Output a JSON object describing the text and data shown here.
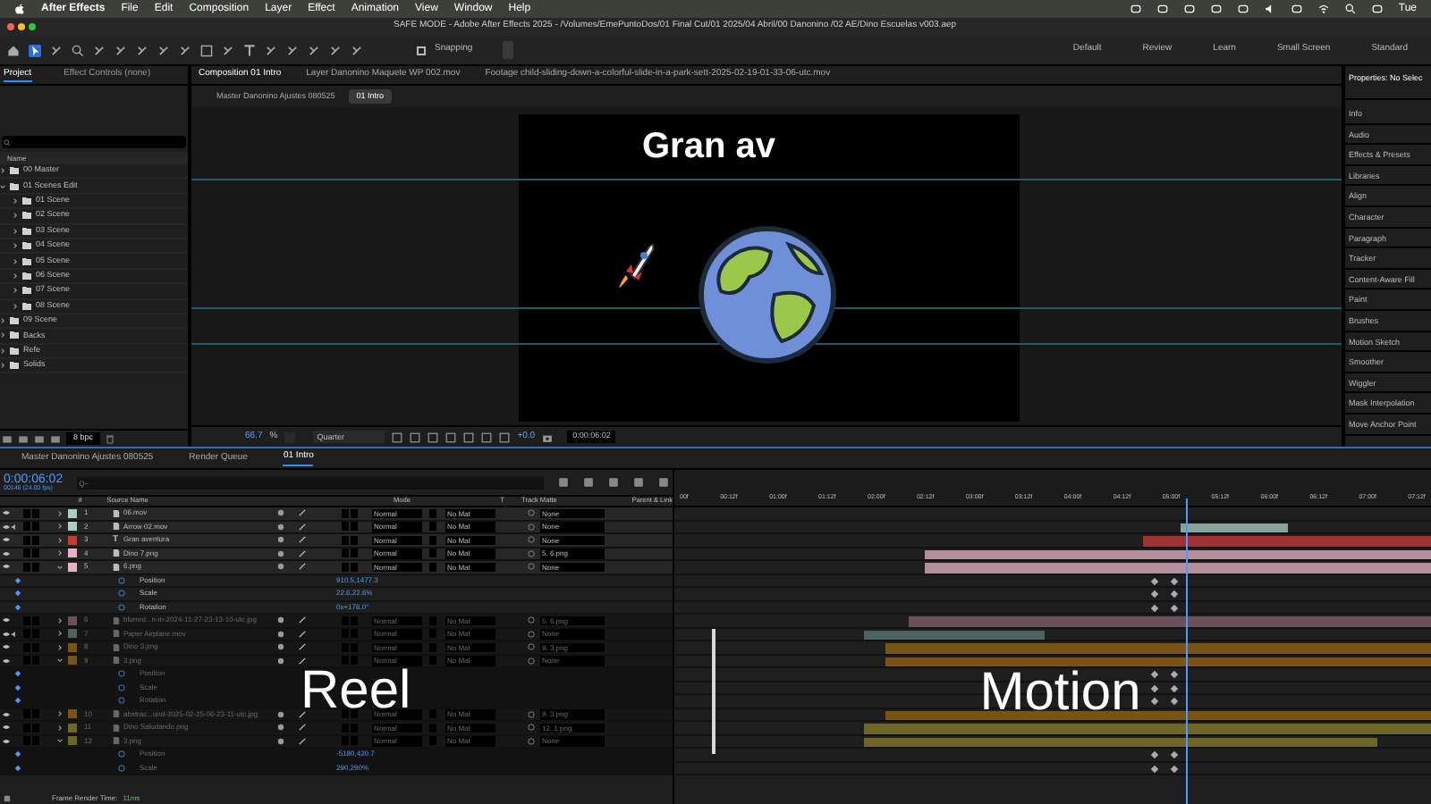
{
  "menu_bar": {
    "app": "After Effects",
    "items": [
      "File",
      "Edit",
      "Composition",
      "Layer",
      "Effect",
      "Animation",
      "View",
      "Window",
      "Help"
    ],
    "clock": "Tue"
  },
  "title_bar": {
    "title": "SAFE MODE - Adobe After Effects 2025 - /Volumes/EmePuntoDos/01 Final Cut/01 2025/04 Abril/00 Danonino /02 AE/Dino Escuelas v003.aep"
  },
  "toolbar": {
    "snapping": {
      "label": "Snapping",
      "checked": false
    },
    "workspaces": [
      "Default",
      "Review",
      "Learn",
      "Small Screen",
      "Standard"
    ]
  },
  "project_panel": {
    "tabs": [
      {
        "label": "Project",
        "selected": true
      },
      {
        "label": "Effect Controls (none)",
        "selected": false
      }
    ],
    "column": "Name",
    "items": [
      {
        "name": "00 Master",
        "expanded": false
      },
      {
        "name": "01 Scenes Edit",
        "expanded": true,
        "children": [
          {
            "name": "01 Scene",
            "expanded": false
          },
          {
            "name": "02 Scene",
            "expanded": false
          },
          {
            "name": "03 Scene",
            "expanded": false
          },
          {
            "name": "04 Scene",
            "expanded": false
          },
          {
            "name": "05 Scene",
            "expanded": false
          },
          {
            "name": "06 Scene",
            "expanded": false
          },
          {
            "name": "07 Scene",
            "expanded": false
          },
          {
            "name": "08 Scene",
            "expanded": false
          }
        ]
      },
      {
        "name": "09 Scene",
        "expanded": false
      },
      {
        "name": "Backs",
        "expanded": false
      },
      {
        "name": "Refe",
        "expanded": false
      },
      {
        "name": "Solids",
        "expanded": false
      }
    ],
    "bpc": "8 bpc"
  },
  "composition_panel": {
    "tabs": [
      {
        "label": "Composition 01 Intro",
        "selected": true
      },
      {
        "label": "Layer Danonino Maquete WP 002.mov",
        "selected": false
      },
      {
        "label": "Footage child-sliding-down-a-colorful-slide-in-a-park-sett-2025-02-19-01-33-06-utc.mov",
        "selected": false
      }
    ],
    "breadcrumbs": [
      {
        "label": "Master Danonino Ajustes 080525",
        "selected": false
      },
      {
        "label": "01 Intro",
        "selected": true
      }
    ],
    "canvas_text": "Gran av",
    "zoom": "66.7",
    "zoom_unit": "%",
    "resolution": "Quarter",
    "exposure": "+0.0",
    "timecode": "0:00:06:02"
  },
  "properties_panel": {
    "title": "Properties: No Selec",
    "items": [
      "Info",
      "Audio",
      "Effects & Presets",
      "Libraries",
      "Align",
      "Character",
      "Paragraph",
      "Tracker",
      "Content-Aware Fill",
      "Paint",
      "Brushes",
      "Motion Sketch",
      "Smoother",
      "Wiggler",
      "Mask Interpolation",
      "Move Anchor Point"
    ]
  },
  "timeline": {
    "tabs": [
      {
        "label": "Master Danonino Ajustes 080525",
        "selected": false
      },
      {
        "label": "Render Queue",
        "selected": false
      },
      {
        "label": "01 Intro",
        "selected": true
      }
    ],
    "timecode": "0:00:06:02",
    "frame_info": "00146 (24.00 fps)",
    "search": {
      "placeholder": "Q~"
    },
    "columns": [
      "#",
      "Source Name",
      "Mode",
      "T",
      "Track Matte",
      "Parent & Link"
    ],
    "ruler": [
      "00f",
      "00:12f",
      "01:00f",
      "01:12f",
      "02:00f",
      "02:12f",
      "03:00f",
      "03:12f",
      "04:00f",
      "04:12f",
      "05:00f",
      "05:12f",
      "06:00f",
      "06:12f",
      "07:00f",
      "07:12f"
    ],
    "rows": [
      {
        "kind": "layer",
        "number": "1",
        "name": "06.mov",
        "color": "#a9cfc6",
        "mode": "Normal",
        "matte": "No Mat",
        "parent": "None",
        "expanded": false,
        "audio": false
      },
      {
        "kind": "layer",
        "number": "2",
        "name": "Arrow 02.mov",
        "color": "#a9cfc6",
        "mode": "Normal",
        "matte": "No Mat",
        "parent": "None",
        "expanded": false,
        "audio": true
      },
      {
        "kind": "layer",
        "number": "3",
        "name": "Gran aventura",
        "icon_glyph": "T",
        "color": "#c9393a",
        "mode": "Normal",
        "matte": "No Mat",
        "parent": "None",
        "expanded": false,
        "audio": false
      },
      {
        "kind": "layer",
        "number": "4",
        "name": "Dino 7.png",
        "color": "#e6b4c6",
        "mode": "Normal",
        "matte": "No Mat",
        "parent": "5. 6.png",
        "expanded": false,
        "audio": false
      },
      {
        "kind": "layer",
        "number": "5",
        "name": "6.png",
        "color": "#e6b4c6",
        "mode": "Normal",
        "matte": "No Mat",
        "parent": "None",
        "expanded": true,
        "audio": false
      },
      {
        "kind": "property",
        "name": "Position",
        "value": "910.5,1477.3"
      },
      {
        "kind": "property",
        "name": "Scale",
        "value": "22.6,22.6%"
      },
      {
        "kind": "property",
        "name": "Rotation",
        "value": "0x+176.0°"
      },
      {
        "kind": "layer",
        "number": "6",
        "name": "blurred...n-in-2024-11-27-23-13-10-utc.jpg",
        "color": "#6a5058",
        "mode": "Normal",
        "matte": "No Mat",
        "parent": "5. 6.png",
        "expanded": false,
        "audio": false
      },
      {
        "kind": "layer",
        "number": "7",
        "name": "Paper Airplane.mov",
        "color": "#4f6262",
        "mode": "Normal",
        "matte": "No Mat",
        "parent": "None",
        "expanded": false,
        "audio": true
      },
      {
        "kind": "layer",
        "number": "8",
        "name": "Dino 3.png",
        "color": "#7a5416",
        "mode": "Normal",
        "matte": "No Mat",
        "parent": "9. 3.png",
        "expanded": false,
        "audio": false
      },
      {
        "kind": "layer",
        "number": "9",
        "name": "3.png",
        "color": "#7a5416",
        "mode": "Normal",
        "matte": "No Mat",
        "parent": "None",
        "expanded": true,
        "audio": false
      },
      {
        "kind": "property",
        "name": "Position"
      },
      {
        "kind": "property",
        "name": "Scale"
      },
      {
        "kind": "property",
        "name": "Rotation"
      },
      {
        "kind": "layer",
        "number": "10",
        "name": "abstrac...und-2025-02-25-06-23-11-utc.jpg",
        "color": "#7a5416",
        "mode": "Normal",
        "matte": "No Mat",
        "parent": "9. 3.png",
        "expanded": false,
        "audio": false
      },
      {
        "kind": "layer",
        "number": "11",
        "name": "Dino Saludando.png",
        "color": "#6e6528",
        "mode": "Normal",
        "matte": "No Mat",
        "parent": "12. 1.png",
        "expanded": false,
        "audio": false
      },
      {
        "kind": "layer",
        "number": "12",
        "name": "3.png",
        "color": "#6e6528",
        "mode": "Normal",
        "matte": "No Mat",
        "parent": "None",
        "expanded": true,
        "audio": false
      },
      {
        "kind": "property",
        "name": "Position",
        "value": "-5180,420.7"
      },
      {
        "kind": "property",
        "name": "Scale",
        "value": "290,290%"
      }
    ],
    "render_time_label": "Frame Render Time:",
    "render_time": "11ms"
  },
  "overlay": {
    "left": "Reel",
    "right": "Motion"
  }
}
